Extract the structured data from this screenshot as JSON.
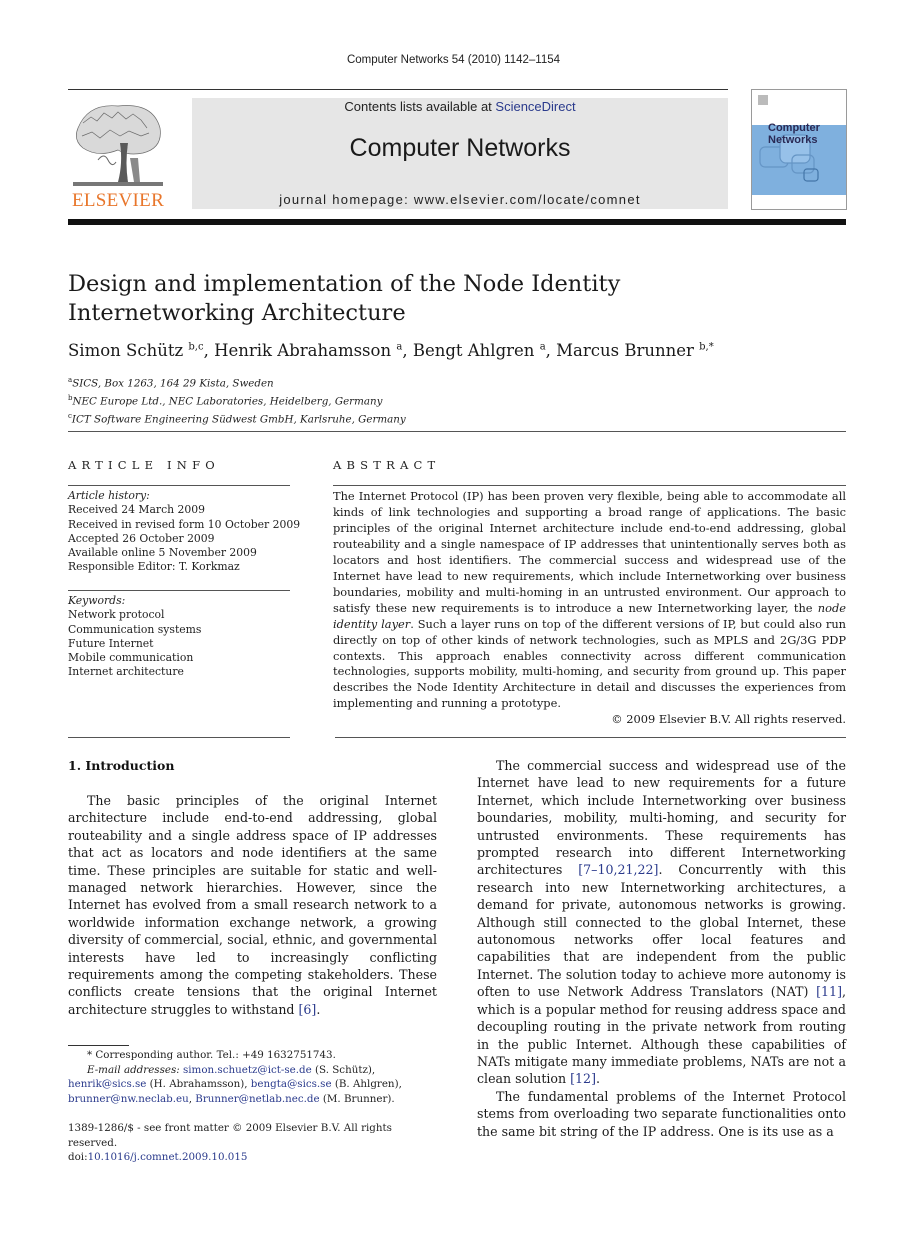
{
  "header": {
    "citation": "Computer Networks 54 (2010) 1142–1154",
    "contents_prefix": "Contents lists available at ",
    "contents_link": "ScienceDirect",
    "journal_title": "Computer Networks",
    "homepage": "journal homepage: www.elsevier.com/locate/comnet",
    "publisher_logo_text": "ELSEVIER",
    "cover_title_line1": "Computer",
    "cover_title_line2": "Networks"
  },
  "colors": {
    "link": "#2a3a8c",
    "elsevier_orange": "#e8762b",
    "banner_gray": "#e6e6e6",
    "cover_blue": "#7fb0de"
  },
  "paper": {
    "title_line1": "Design and implementation of the Node Identity",
    "title_line2": "Internetworking Architecture",
    "authors": [
      {
        "name": "Simon Schütz",
        "sup": "b,c",
        "sep": ", "
      },
      {
        "name": "Henrik Abrahamsson",
        "sup": "a",
        "sep": ", "
      },
      {
        "name": "Bengt Ahlgren",
        "sup": "a",
        "sep": ", "
      },
      {
        "name": "Marcus Brunner",
        "sup": "b,*",
        "sep": ""
      }
    ],
    "affiliations": [
      {
        "sup": "a",
        "text": "SICS, Box 1263, 164 29 Kista, Sweden"
      },
      {
        "sup": "b",
        "text": "NEC Europe Ltd., NEC Laboratories, Heidelberg, Germany"
      },
      {
        "sup": "c",
        "text": "ICT Software Engineering Südwest GmbH, Karlsruhe, Germany"
      }
    ]
  },
  "article_info": {
    "heading": "ARTICLE INFO",
    "history_label": "Article history:",
    "history": [
      "Received 24 March 2009",
      "Received in revised form 10 October 2009",
      "Accepted 26 October 2009",
      "Available online 5 November 2009",
      "Responsible Editor: T. Korkmaz"
    ],
    "keywords_label": "Keywords:",
    "keywords": [
      "Network protocol",
      "Communication systems",
      "Future Internet",
      "Mobile communication",
      "Internet architecture"
    ]
  },
  "abstract": {
    "heading": "ABSTRACT",
    "text_before_italic": "The Internet Protocol (IP) has been proven very flexible, being able to accommodate all kinds of link technologies and supporting a broad range of applications. The basic principles of the original Internet architecture include end-to-end addressing, global routeability and a single namespace of IP addresses that unintentionally serves both as locators and host identifiers. The commercial success and widespread use of the Internet have lead to new requirements, which include Internetworking over business boundaries, mobility and multi-homing in an untrusted environment. Our approach to satisfy these new requirements is to introduce a new Internetworking layer, the ",
    "italic": "node identity layer",
    "text_after_italic": ". Such a layer runs on top of the different versions of IP, but could also run directly on top of other kinds of network technologies, such as MPLS and 2G/3G PDP contexts. This approach enables connectivity across different communication technologies, supports mobility, multi-homing, and security from ground up. This paper describes the Node Identity Architecture in detail and discusses the experiences from implementing and running a prototype.",
    "copyright": "© 2009 Elsevier B.V. All rights reserved."
  },
  "body": {
    "section_heading": "1. Introduction",
    "left_para1_text": "The basic principles of the original Internet architecture include end-to-end addressing, global routeability and a single address space of IP addresses that act as locators and node identifiers at the same time. These principles are suitable for static and well-managed network hierarchies. However, since the Internet has evolved from a small research network to a worldwide information exchange network, a growing diversity of commercial, social, ethnic, and governmental interests have led to increasingly conflicting requirements among the competing stakeholders. These conflicts create tensions that the original Internet architecture struggles to withstand ",
    "left_para1_ref": "[6]",
    "left_para1_end": ".",
    "right_para1_a": "The commercial success and widespread use of the Internet have lead to new requirements for a future Internet, which include Internetworking over business boundaries, mobility, multi-homing, and security for untrusted environments. These requirements has prompted research into different Internetworking architectures ",
    "right_para1_ref1": "[7–10,21,22]",
    "right_para1_b": ". Concurrently with this research into new Internetworking architectures, a demand for private, autonomous networks is growing. Although still connected to the global Internet, these autonomous networks offer local features and capabilities that are independent from the public Internet. The solution today to achieve more autonomy is often to use Network Address Translators (NAT) ",
    "right_para1_ref2": "[11]",
    "right_para1_c": ", which is a popular method for reusing address space and decoupling routing in the private network from routing in the public Internet. Although these capabilities of NATs mitigate many immediate problems, NATs are not a clean solution ",
    "right_para1_ref3": "[12]",
    "right_para1_d": ".",
    "right_para2": "The fundamental problems of the Internet Protocol stems from overloading two separate functionalities onto the same bit string of the IP address. One is its use as a"
  },
  "footnotes": {
    "corresponding": "* Corresponding author. Tel.: +49 1632751743.",
    "email_label": "E-mail addresses: ",
    "emails": [
      {
        "addr": "simon.schuetz@ict-se.de",
        "who": " (S. Schütz), "
      },
      {
        "addr": "henrik@sics.se",
        "who": " (H. Abrahamsson), "
      },
      {
        "addr": "bengta@sics.se",
        "who": " (B. Ahlgren), "
      },
      {
        "addr": "brunner@nw.neclab.eu",
        "who": ", "
      },
      {
        "addr": "Brunner@netlab.nec.de",
        "who": " (M. Brunner)."
      }
    ],
    "front_matter": "1389-1286/$ - see front matter © 2009 Elsevier B.V. All rights reserved.",
    "doi_label": "doi:",
    "doi": "10.1016/j.comnet.2009.10.015"
  }
}
